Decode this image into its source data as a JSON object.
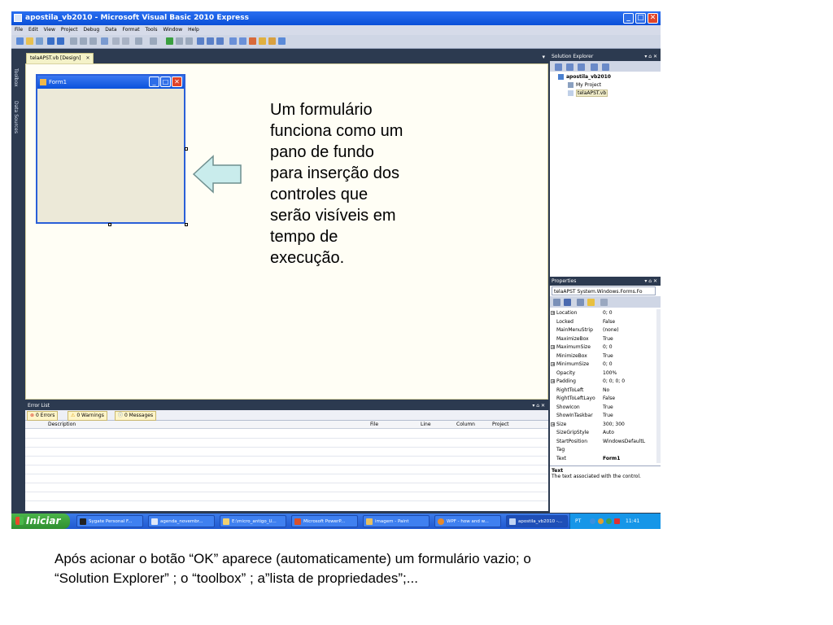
{
  "window": {
    "title": "apostila_vb2010 - Microsoft Visual Basic 2010 Express",
    "minimize": "_",
    "maximize": "□",
    "close": "✕"
  },
  "menu": [
    "File",
    "Edit",
    "View",
    "Project",
    "Debug",
    "Data",
    "Format",
    "Tools",
    "Window",
    "Help"
  ],
  "left_strip": {
    "toolbox": "Toolbox",
    "data_sources": "Data Sources"
  },
  "doc_tab": {
    "label": "telaAPST.vb [Design]",
    "close": "✕"
  },
  "form": {
    "title": "Form1"
  },
  "annotation_lines": [
    "Um formulário",
    "funciona como um",
    "pano de fundo",
    "para inserção dos",
    "controles que",
    "serão visíveis em",
    "tempo de",
    "execução."
  ],
  "error_list": {
    "title": "Error List",
    "pins": "▾ ⌂ ✕",
    "tabs": [
      "0 Errors",
      "0 Warnings",
      "0 Messages"
    ],
    "columns": [
      "Description",
      "File",
      "Line",
      "Column",
      "Project"
    ]
  },
  "solution_explorer": {
    "title": "Solution Explorer",
    "pins": "▾ ⌂ ✕",
    "items": [
      "apostila_vb2010",
      "My Project",
      "telaAPST.vb"
    ]
  },
  "properties": {
    "title": "Properties",
    "pins": "▾ ⌂ ✕",
    "object": "telaAPST System.Windows.Forms.Fo",
    "rows": [
      {
        "name": "Location",
        "value": "0; 0",
        "expandable": true
      },
      {
        "name": "Locked",
        "value": "False",
        "expandable": false
      },
      {
        "name": "MainMenuStrip",
        "value": "(none)",
        "expandable": false
      },
      {
        "name": "MaximizeBox",
        "value": "True",
        "expandable": false
      },
      {
        "name": "MaximumSize",
        "value": "0; 0",
        "expandable": true
      },
      {
        "name": "MinimizeBox",
        "value": "True",
        "expandable": false
      },
      {
        "name": "MinimumSize",
        "value": "0; 0",
        "expandable": true
      },
      {
        "name": "Opacity",
        "value": "100%",
        "expandable": false
      },
      {
        "name": "Padding",
        "value": "0; 0; 0; 0",
        "expandable": true
      },
      {
        "name": "RightToLeft",
        "value": "No",
        "expandable": false
      },
      {
        "name": "RightToLeftLayo",
        "value": "False",
        "expandable": false
      },
      {
        "name": "ShowIcon",
        "value": "True",
        "expandable": false
      },
      {
        "name": "ShowInTaskbar",
        "value": "True",
        "expandable": false
      },
      {
        "name": "Size",
        "value": "300; 300",
        "expandable": true
      },
      {
        "name": "SizeGripStyle",
        "value": "Auto",
        "expandable": false
      },
      {
        "name": "StartPosition",
        "value": "WindowsDefaultL",
        "expandable": false
      },
      {
        "name": "Tag",
        "value": "",
        "expandable": false
      },
      {
        "name": "Text",
        "value": "Form1",
        "expandable": false,
        "bold": true
      }
    ],
    "desc_title": "Text",
    "desc_text": "The text associated with the control."
  },
  "taskbar": {
    "start": "Iniciar",
    "tasks": [
      "Sygate Personal F...",
      "agenda_novembr...",
      "E:\\micro_antigo_U...",
      "Microsoft PowerP...",
      "imagem - Paint",
      "WPF - how and w...",
      "apostila_vb2010 -..."
    ],
    "lang": "PT",
    "clock": "11:41"
  },
  "caption_lines": [
    "Após acionar o botão “OK” aparece (automaticamente) um formulário vazio; o",
    "“Solution Explorer” ; o “toolbox” ; a”lista de propriedades”;..."
  ],
  "colors": {
    "titlebar": "#0a4fd8",
    "ide_dark": "#2c3a50",
    "designer_bg": "#fffef5",
    "form_bg": "#ece9d8",
    "arrow": "#c9ecec",
    "taskbar": "#1f58d0",
    "start": "#2f8f30"
  }
}
